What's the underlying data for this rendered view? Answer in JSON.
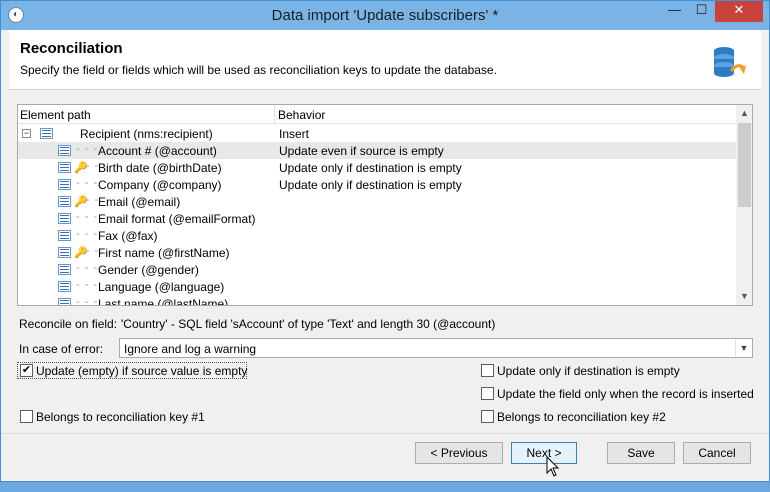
{
  "window": {
    "title": "Data import 'Update subscribers' *",
    "min_glyph": "—",
    "max_glyph": "☐",
    "close_glyph": "✕"
  },
  "header": {
    "title": "Reconciliation",
    "description": "Specify the field or fields which will be used as reconciliation keys to update the database."
  },
  "tree": {
    "columns": {
      "path": "Element path",
      "behavior": "Behavior"
    },
    "rows": [
      {
        "name": "Recipient (nms:recipient)",
        "behavior": "Insert",
        "root": true,
        "key": false,
        "selected": false
      },
      {
        "name": "Account # (@account)",
        "behavior": "Update even if source is empty",
        "root": false,
        "key": false,
        "selected": true
      },
      {
        "name": "Birth date (@birthDate)",
        "behavior": "Update only if destination is empty",
        "root": false,
        "key": true,
        "selected": false
      },
      {
        "name": "Company (@company)",
        "behavior": "Update only if destination is empty",
        "root": false,
        "key": false,
        "selected": false
      },
      {
        "name": "Email (@email)",
        "behavior": "",
        "root": false,
        "key": true,
        "selected": false
      },
      {
        "name": "Email format (@emailFormat)",
        "behavior": "",
        "root": false,
        "key": false,
        "selected": false
      },
      {
        "name": "Fax (@fax)",
        "behavior": "",
        "root": false,
        "key": false,
        "selected": false
      },
      {
        "name": "First name (@firstName)",
        "behavior": "",
        "root": false,
        "key": true,
        "selected": false
      },
      {
        "name": "Gender (@gender)",
        "behavior": "",
        "root": false,
        "key": false,
        "selected": false
      },
      {
        "name": "Language (@language)",
        "behavior": "",
        "root": false,
        "key": false,
        "selected": false
      },
      {
        "name": "Last name (@lastName)",
        "behavior": "",
        "root": false,
        "key": false,
        "selected": false
      }
    ]
  },
  "reconcile": {
    "label": "Reconcile on field:",
    "value": "'Country' - SQL field 'sAccount' of type 'Text' and length 30 (@account)"
  },
  "error": {
    "label": "In case of error:",
    "selected": "Ignore and log a warning"
  },
  "options": {
    "update_empty": {
      "label": "Update (empty) if source value is empty",
      "checked": true
    },
    "update_only_dest_empty": {
      "label": "Update only if destination is empty",
      "checked": false
    },
    "update_when_inserted": {
      "label": "Update the field only when the record is inserted",
      "checked": false
    },
    "key1": {
      "label": "Belongs to reconciliation key #1",
      "checked": false
    },
    "key2": {
      "label": "Belongs to reconciliation key #2",
      "checked": false
    }
  },
  "buttons": {
    "previous": "< Previous",
    "next": "Next >",
    "save": "Save",
    "cancel": "Cancel"
  }
}
